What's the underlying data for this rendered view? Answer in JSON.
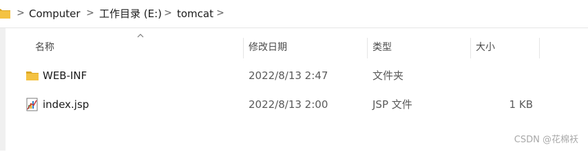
{
  "breadcrumb": {
    "items": [
      "Computer",
      "工作目录 (E:)",
      "tomcat"
    ],
    "separator": ">"
  },
  "columns": {
    "name": "名称",
    "modified": "修改日期",
    "type": "类型",
    "size": "大小",
    "sort_column": "name",
    "sort_direction": "ascending"
  },
  "files": [
    {
      "name": "WEB-INF",
      "modified": "2022/8/13 2:47",
      "type": "文件夹",
      "size": "",
      "icon": "folder-icon"
    },
    {
      "name": "index.jsp",
      "modified": "2022/8/13 2:00",
      "type": "JSP 文件",
      "size": "1 KB",
      "icon": "jsp-file-icon"
    }
  ],
  "watermark": "CSDN @花棉袄",
  "colors": {
    "folder": "#f4c242",
    "folder_dark": "#dca725",
    "separator_line": "#e5e5e5"
  }
}
